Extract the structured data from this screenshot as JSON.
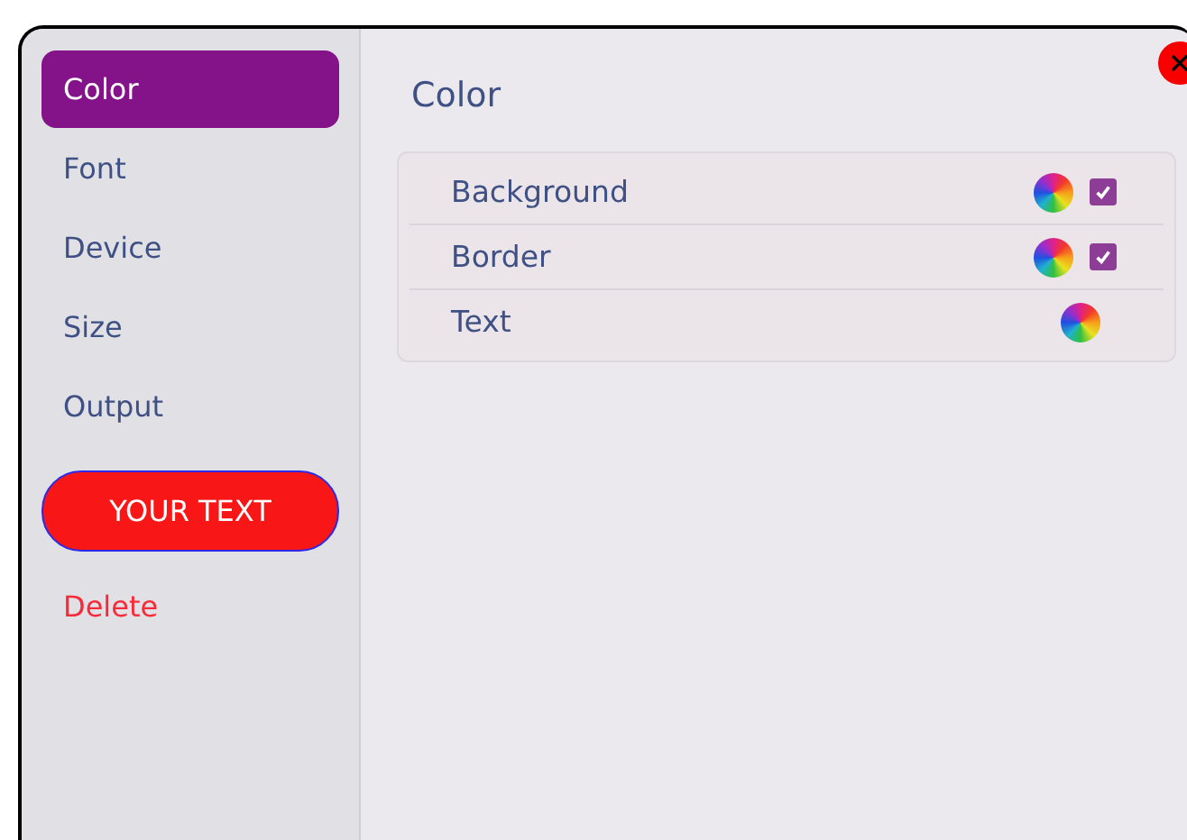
{
  "sidebar": {
    "items": [
      {
        "label": "Color",
        "selected": true
      },
      {
        "label": "Font",
        "selected": false
      },
      {
        "label": "Device",
        "selected": false
      },
      {
        "label": "Size",
        "selected": false
      },
      {
        "label": "Output",
        "selected": false
      }
    ],
    "preview_button": "YOUR TEXT",
    "delete_link": "Delete"
  },
  "panel": {
    "title": "Color",
    "rows": [
      {
        "label": "Background",
        "kind": "toggle",
        "checked": true
      },
      {
        "label": "Border",
        "kind": "toggle",
        "checked": true
      },
      {
        "label": "Text",
        "kind": "plain"
      }
    ]
  }
}
